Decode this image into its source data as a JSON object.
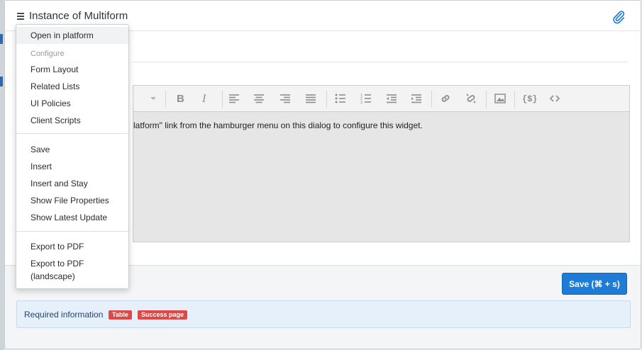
{
  "dialog": {
    "title": "Instance of Multiform",
    "hamburger_icon": "hamburger-menu-icon",
    "attachment_icon": "paperclip-icon",
    "accent_color": "#1e7bd6"
  },
  "menu": {
    "items": [
      {
        "label": "Open in platform"
      },
      {
        "label": "Configure"
      },
      {
        "label": "Form Layout"
      },
      {
        "label": "Related Lists"
      },
      {
        "label": "UI Policies"
      },
      {
        "label": "Client Scripts"
      },
      {
        "label": "Save"
      },
      {
        "label": "Insert"
      },
      {
        "label": "Insert and Stay"
      },
      {
        "label": "Show File Properties"
      },
      {
        "label": "Show Latest Update"
      },
      {
        "label": "Export to PDF"
      },
      {
        "label": "Export to PDF"
      },
      {
        "label": "(landscape)"
      }
    ]
  },
  "editor": {
    "content": "latform\" link from the hamburger menu on this dialog to configure this widget.",
    "toolbar_icons": [
      "dropdown-caret-icon",
      "bold-icon",
      "italic-icon",
      "align-left-icon",
      "align-center-icon",
      "align-right-icon",
      "justify-icon",
      "bullet-list-icon",
      "numbered-list-icon",
      "outdent-icon",
      "indent-icon",
      "link-icon",
      "unlink-icon",
      "image-icon",
      "code-braces-icon",
      "source-code-icon"
    ]
  },
  "footer": {
    "save_label": "Save  (⌘ + s)",
    "required_info": "Required information",
    "badges": [
      "Table",
      "Success page"
    ],
    "badge_color": "#e04848"
  }
}
